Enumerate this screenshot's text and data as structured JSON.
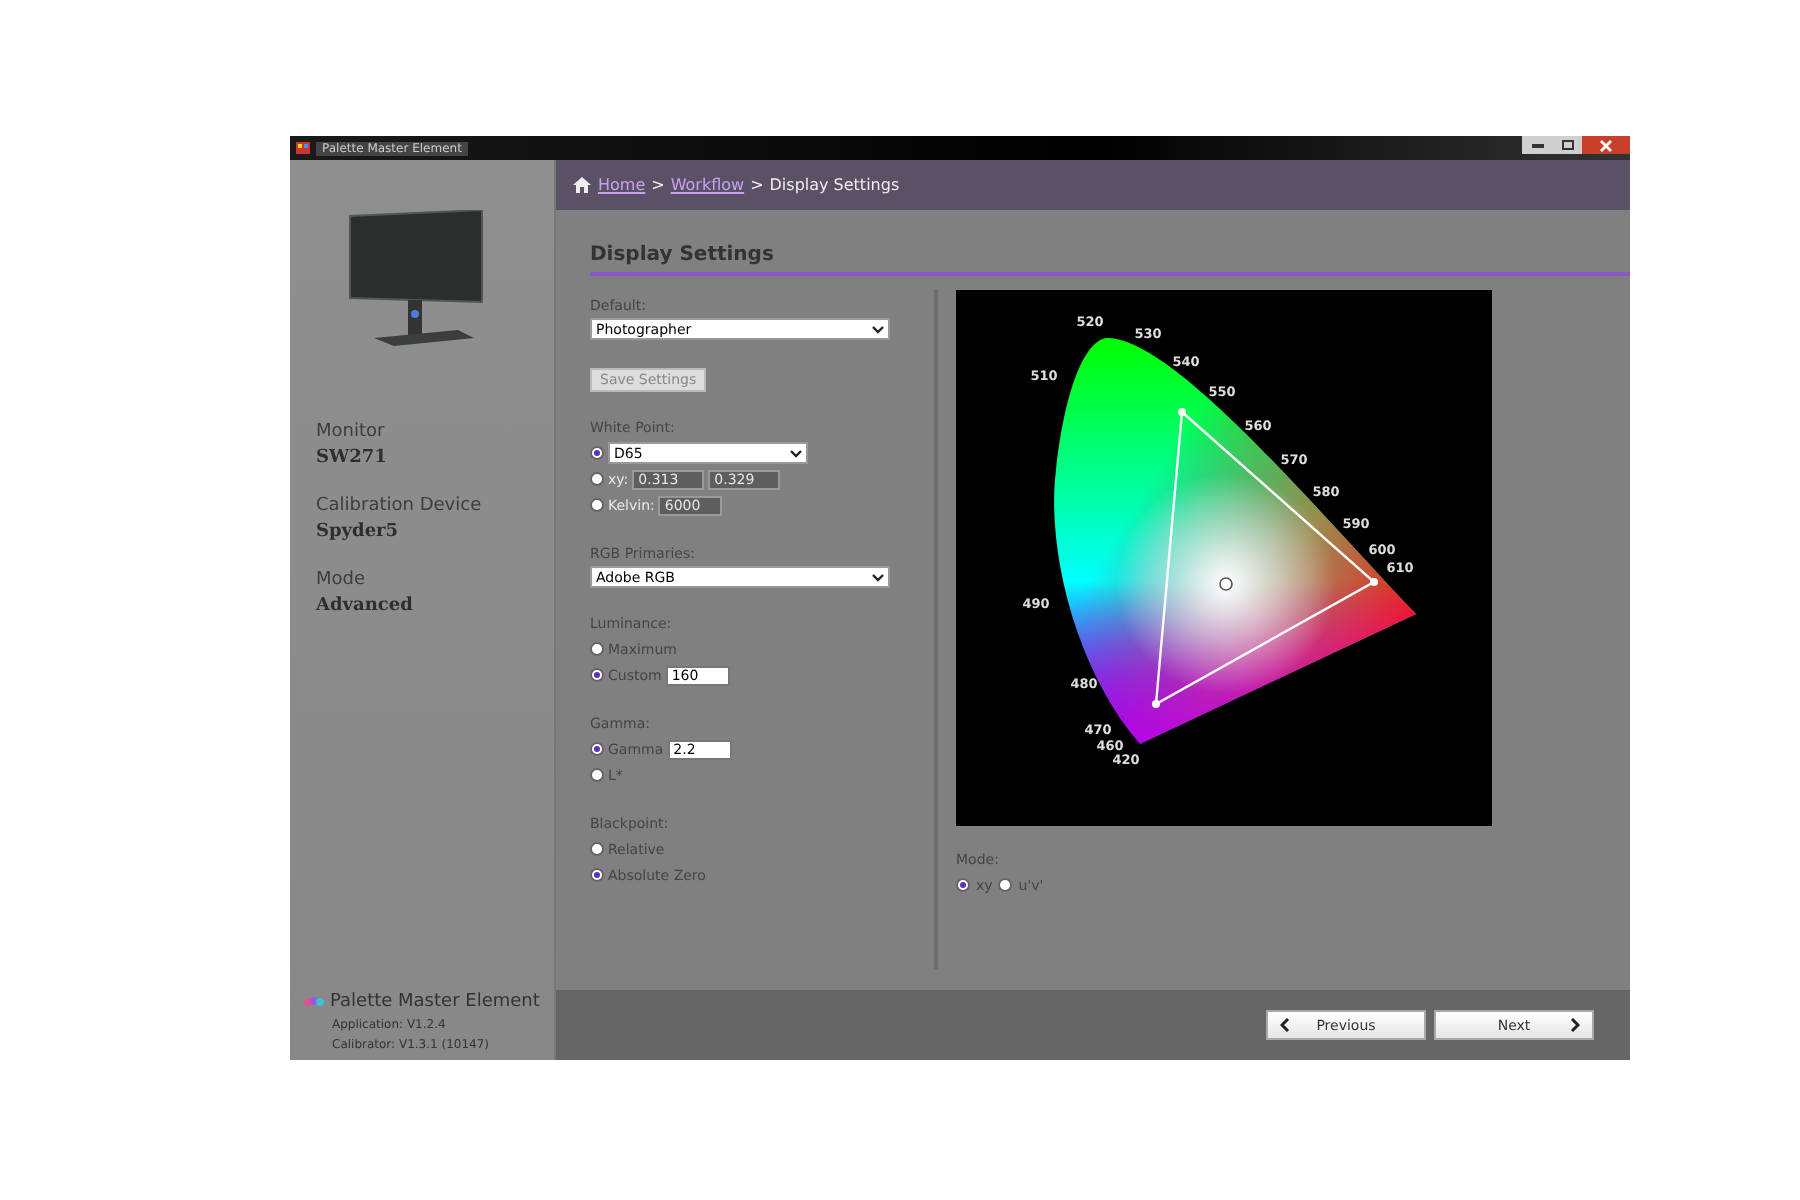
{
  "window": {
    "title": "Palette Master Element"
  },
  "breadcrumb": {
    "separator": ">",
    "items": [
      {
        "label": "Home",
        "kind": "link"
      },
      {
        "label": "Workflow",
        "kind": "link"
      },
      {
        "label": "Display Settings",
        "kind": "current"
      }
    ]
  },
  "sidebar": {
    "info": [
      {
        "label": "Monitor",
        "value": "SW271"
      },
      {
        "label": "Calibration Device",
        "value": "Spyder5"
      },
      {
        "label": "Mode",
        "value": "Advanced"
      }
    ],
    "product": "Palette Master Element",
    "versions": [
      "Application: V1.2.4",
      "Calibrator: V1.3.1 (10147)"
    ]
  },
  "page_title": "Display Settings",
  "form": [
    {
      "kind": "select",
      "label": "Default:",
      "value": "Photographer"
    },
    {
      "kind": "button",
      "label": "Save Settings"
    },
    {
      "kind": "radios",
      "label": "White Point:",
      "options": [
        {
          "selected": true,
          "dropdown": "D65"
        },
        {
          "label": "xy:",
          "selected": false,
          "inputs": [
            "0.313",
            "0.329"
          ],
          "disabled": true
        },
        {
          "label": "Kelvin:",
          "selected": false,
          "inputs": [
            "6000"
          ],
          "disabled": true
        }
      ]
    },
    {
      "kind": "select",
      "label": "RGB Primaries:",
      "value": "Adobe RGB"
    },
    {
      "kind": "radios",
      "label": "Luminance:",
      "options": [
        {
          "label": "Maximum",
          "selected": false
        },
        {
          "label": "Custom",
          "selected": true,
          "inputs": [
            "160"
          ],
          "disabled": false
        }
      ]
    },
    {
      "kind": "radios",
      "label": "Gamma:",
      "options": [
        {
          "label": "Gamma",
          "selected": true,
          "inputs": [
            "2.2"
          ],
          "disabled": false
        },
        {
          "label": "L*",
          "selected": false
        }
      ]
    },
    {
      "kind": "radios",
      "label": "Blackpoint:",
      "options": [
        {
          "label": "Relative",
          "selected": false
        },
        {
          "label": "Absolute Zero",
          "selected": true
        }
      ]
    }
  ],
  "diagram": {
    "wavelengths": [
      "520",
      "530",
      "540",
      "550",
      "560",
      "570",
      "580",
      "590",
      "600",
      "610",
      "510",
      "490",
      "480",
      "470",
      "460",
      "420"
    ]
  },
  "mode": {
    "label": "Mode:",
    "options": [
      {
        "label": "xy",
        "selected": true
      },
      {
        "label": "u'v'",
        "selected": false
      }
    ]
  },
  "footer": {
    "previous": "Previous",
    "next": "Next"
  }
}
